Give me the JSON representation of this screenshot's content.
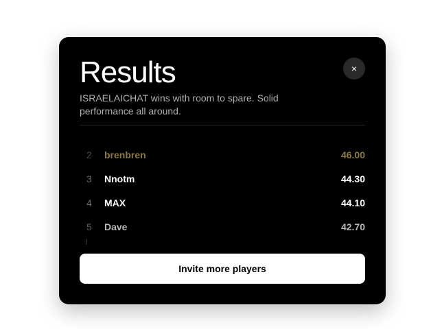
{
  "modal": {
    "title": "Results",
    "close_icon": "×",
    "close_icon_name": "close-icon",
    "subtitle": "ISRAELAICHAT wins with room to spare. Solid performance all around.",
    "results": [
      {
        "rank": "2",
        "name": "brenbren",
        "score": "46.00",
        "style": "gold"
      },
      {
        "rank": "3",
        "name": "Nnotm",
        "score": "44.30",
        "style": "white"
      },
      {
        "rank": "4",
        "name": "MAX",
        "score": "44.10",
        "style": "white"
      },
      {
        "rank": "5",
        "name": "Dave",
        "score": "42.70",
        "style": "muted"
      }
    ],
    "invite_label": "Invite more players"
  },
  "colors": {
    "background": "#000000",
    "gold": "#8c7a3f",
    "button": "#ffffff"
  }
}
